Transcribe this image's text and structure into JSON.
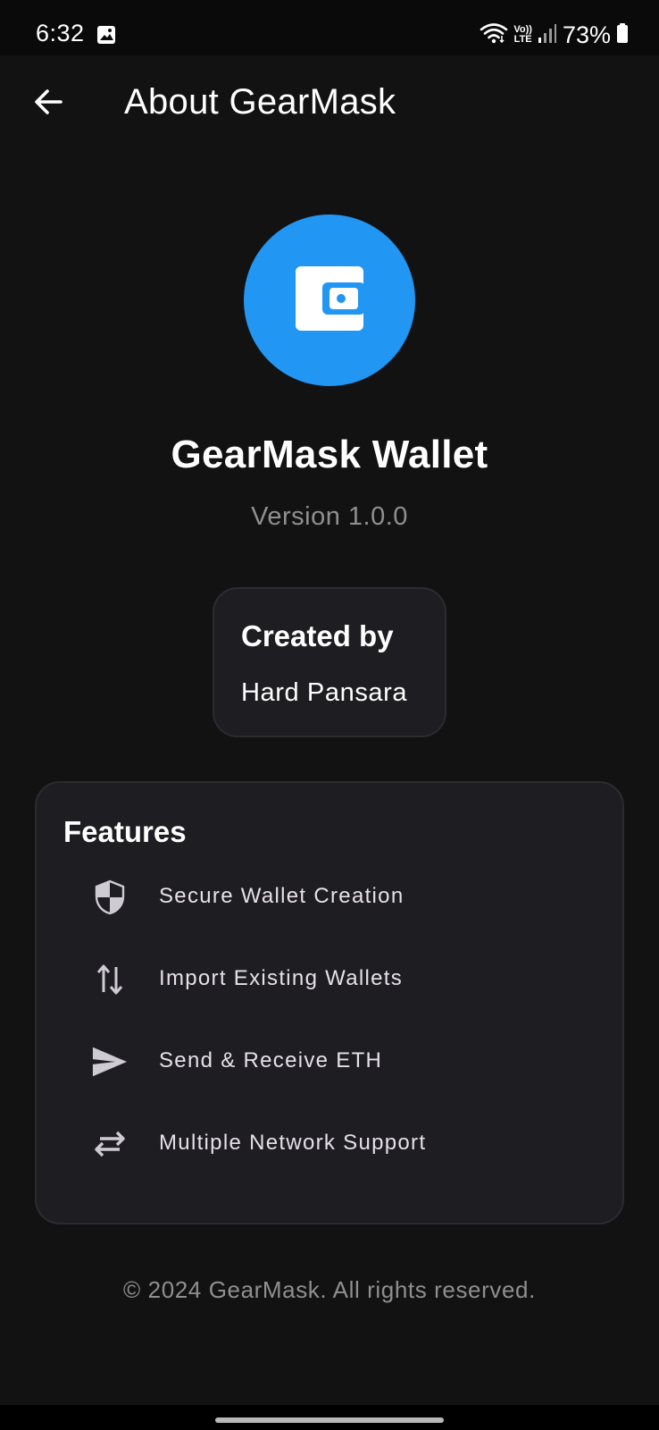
{
  "status_bar": {
    "time": "6:32",
    "battery_text": "73%",
    "network_label_top": "Vo))",
    "network_label_bottom": "LTE",
    "icons": [
      "gallery-icon",
      "wifi-icon",
      "volte-icon",
      "signal-icon",
      "battery-icon"
    ]
  },
  "app_bar": {
    "title": "About GearMask",
    "back_icon": "arrow-left-icon"
  },
  "app_info": {
    "logo_icon": "wallet-icon",
    "name": "GearMask Wallet",
    "version": "Version 1.0.0"
  },
  "created_by": {
    "label": "Created by",
    "name": "Hard Pansara"
  },
  "features": {
    "title": "Features",
    "items": [
      {
        "icon": "shield-icon",
        "label": "Secure Wallet Creation"
      },
      {
        "icon": "import-export-icon",
        "label": "Import Existing Wallets"
      },
      {
        "icon": "send-icon",
        "label": "Send & Receive ETH"
      },
      {
        "icon": "swap-horiz-icon",
        "label": "Multiple Network Support"
      }
    ]
  },
  "footer": {
    "copyright": "© 2024 GearMask. All rights reserved."
  },
  "colors": {
    "background": "#121212",
    "card": "#1e1d22",
    "accent": "#2196f3",
    "muted_text": "#8f8f8f"
  }
}
